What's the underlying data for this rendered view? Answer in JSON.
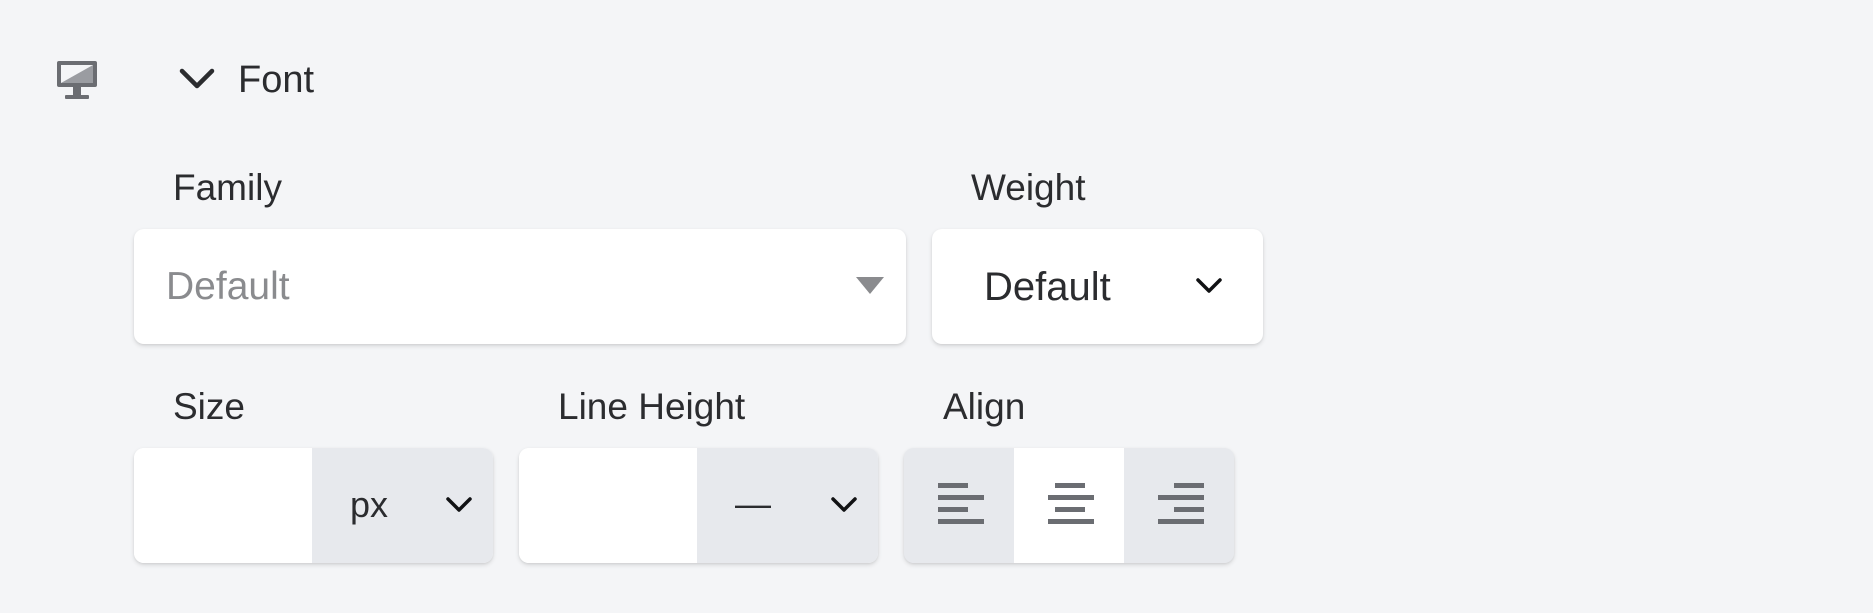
{
  "section": {
    "title": "Font",
    "device_icon": "desktop-monitor-icon",
    "toggle_icon": "chevron-down-icon"
  },
  "family": {
    "label": "Family",
    "value": "Default",
    "icon": "caret-down-icon"
  },
  "weight": {
    "label": "Weight",
    "value": "Default",
    "icon": "chevron-down-icon"
  },
  "size": {
    "label": "Size",
    "value": "",
    "unit": "px"
  },
  "line_height": {
    "label": "Line Height",
    "value": "",
    "unit": "—"
  },
  "align": {
    "label": "Align",
    "options": [
      {
        "name": "left",
        "icon": "align-left-icon",
        "active": false
      },
      {
        "name": "center",
        "icon": "align-center-icon",
        "active": true
      },
      {
        "name": "right",
        "icon": "align-right-icon",
        "active": false
      }
    ]
  },
  "colors": {
    "background": "#f4f5f7",
    "card": "#ffffff",
    "muted_segment": "#e7e9ed",
    "text": "#2b2c2f",
    "placeholder": "#8a8b8e",
    "icon": "#6b6d72"
  }
}
